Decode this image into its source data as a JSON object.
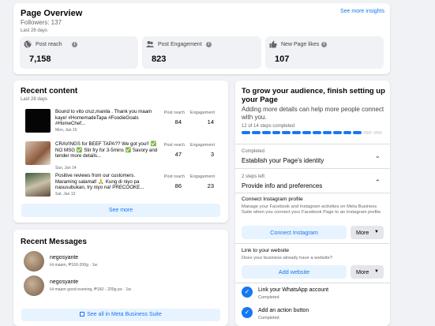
{
  "overview": {
    "title": "Page Overview",
    "followers": "Followers: 137",
    "range": "Last 28 days",
    "see_more": "See more insights",
    "metrics": [
      {
        "label": "Post reach",
        "value": "7,158",
        "icon": "globe-icon"
      },
      {
        "label": "Post Engagement",
        "value": "823",
        "icon": "people-icon"
      },
      {
        "label": "New Page likes",
        "value": "107",
        "icon": "thumbs-up-icon"
      }
    ]
  },
  "recent_content": {
    "title": "Recent content",
    "range": "Last 28 days",
    "reach_label": "Post reach",
    "engagement_label": "Engagement",
    "posts": [
      {
        "text": "Bound to vito cruz,manila . Thank you maam kaye! #HomemadeTapa #FoodieGoals #HomeChef...",
        "date": "Mon, Jan 15",
        "reach": "84",
        "engagement": "14"
      },
      {
        "text": "CRAVINGS for BEEF TAPA?? We got you!! ✅ NO MSG ✅ Stir fry for 3-5mins ✅ Savory and tender more details...",
        "date": "Sun, Jan 14",
        "reach": "47",
        "engagement": "3"
      },
      {
        "text": "Positive reviews from our customers. Maraming salamat! 🙏 Kung di niyo pa nasusubukan, try niyo na! PRECOOKE...",
        "date": "Sat, Jan 13",
        "reach": "86",
        "engagement": "23"
      }
    ],
    "see_more": "See more"
  },
  "messages": {
    "title": "Recent Messages",
    "items": [
      {
        "name": "negosyante",
        "text": "Hi maam, ₱160-200g · 1w"
      },
      {
        "name": "negosyante",
        "text": "Hi maam good evening, ₱160 - 200g po · 1w"
      }
    ],
    "see_all": "See all in Meta Business Suite"
  },
  "grow": {
    "title": "To grow your audience, finish setting up your Page",
    "desc": "Adding more details can help more people connect with you.",
    "steps": "12 of 14 steps completed",
    "steps_done": 12,
    "steps_total": 14,
    "accent": "#1877f2",
    "completed_label": "Completed",
    "identity": "Establish your Page's identity",
    "steps_left": "2 steps left",
    "info": "Provide info and preferences",
    "instagram_title": "Connect Instagram profile",
    "instagram_desc": "Manage your Facebook and Instagram activities on Meta Business Suite when you connect your Facebook Page to an Instagram profile.",
    "connect_btn": "Connect Instagram",
    "more_label": "More",
    "website_title": "Link to your website",
    "website_desc": "Does your business already have a website?",
    "website_btn": "Add website",
    "whatsapp_title": "Link your WhatsApp account",
    "whatsapp_status": "Completed",
    "action_title": "Add an action button",
    "action_status": "Completed"
  }
}
